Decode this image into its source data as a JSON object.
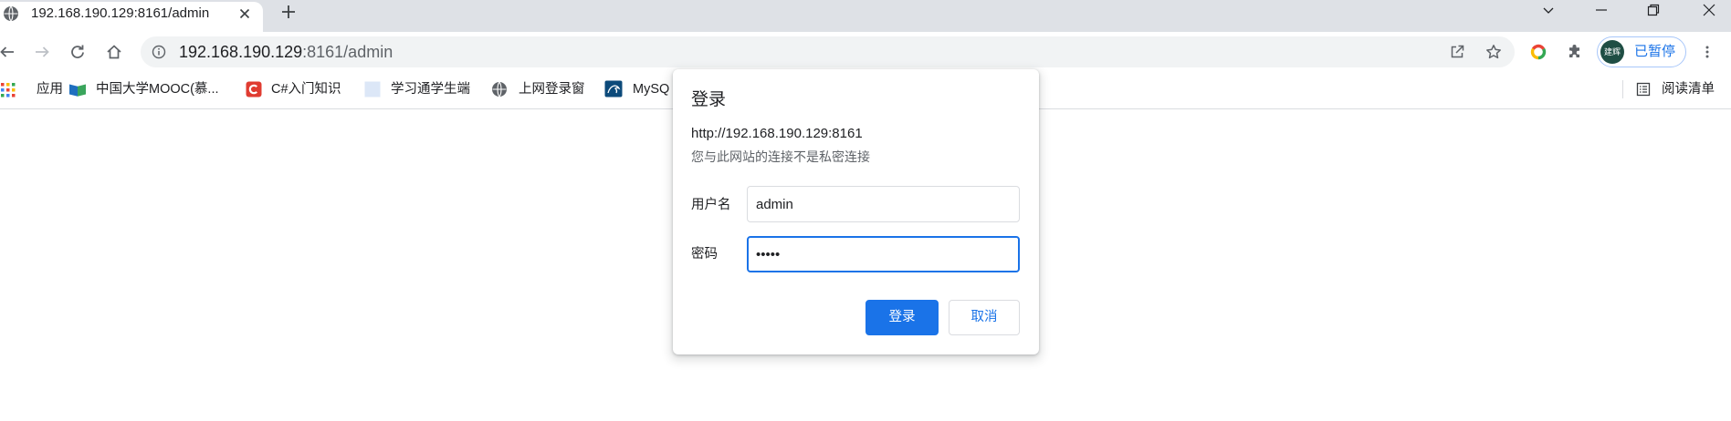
{
  "browser": {
    "tab": {
      "title": "192.168.190.129:8161/admin",
      "favicon": "globe-icon",
      "close_icon": "close-icon"
    },
    "new_tab_icon": "plus-icon",
    "window_controls": [
      "chevron-down-icon",
      "minimize-icon",
      "restore-icon",
      "close-icon"
    ]
  },
  "toolbar": {
    "nav_icons": [
      "back-arrow-icon",
      "forward-arrow-icon",
      "reload-icon",
      "home-icon"
    ],
    "omnibox": {
      "security_icon": "info-icon",
      "url_host": "192.168.190.129",
      "url_path": ":8161/admin",
      "action_icons": [
        "share-icon",
        "star-icon"
      ]
    },
    "extension_icons": [
      "google-ring-icon",
      "puzzle-icon"
    ],
    "profile": {
      "avatar_text": "建辉",
      "status": "已暂停"
    },
    "menu_icon": "kebab-menu-icon"
  },
  "bookmarks": [
    {
      "label": "应用",
      "icon": "apps-grid-icon"
    },
    {
      "label": "中国大学MOOC(慕...",
      "icon": "mooc-icon"
    },
    {
      "label": "C#入门知识",
      "icon": "c-logo-icon"
    },
    {
      "label": "学习通学生端",
      "icon": "page-icon"
    },
    {
      "label": "上网登录窗",
      "icon": "globe-icon"
    },
    {
      "label": "MySQ",
      "icon": "mysql-icon"
    }
  ],
  "reading_list": {
    "label": "阅读清单",
    "icon": "reading-list-icon"
  },
  "auth_dialog": {
    "title": "登录",
    "origin": "http://192.168.190.129:8161",
    "warning": "您与此网站的连接不是私密连接",
    "username_label": "用户名",
    "username_value": "admin",
    "password_label": "密码",
    "password_value": "•••••",
    "login_button": "登录",
    "cancel_button": "取消"
  },
  "colors": {
    "accent": "#1a73e8",
    "tab_strip": "#dee1e6",
    "omnibox": "#f1f3f4",
    "avatar": "#1f4e44",
    "text": "#202124",
    "secondary_text": "#5f6368"
  }
}
